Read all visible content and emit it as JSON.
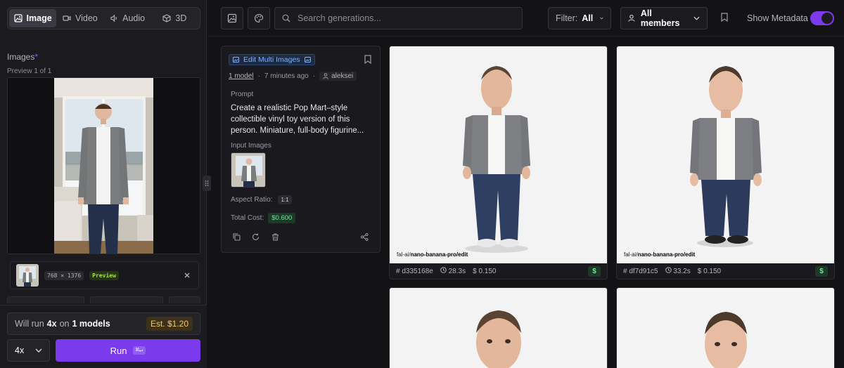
{
  "mode_tabs": [
    {
      "label": "Image",
      "icon": "image-icon",
      "active": true
    },
    {
      "label": "Video",
      "icon": "video-icon",
      "active": false
    },
    {
      "label": "Audio",
      "icon": "audio-icon",
      "active": false
    },
    {
      "label": "3D",
      "icon": "cube-icon",
      "active": false
    }
  ],
  "left_panel": {
    "images_label": "Images",
    "required_mark": "*",
    "preview_counter": "Preview 1 of 1",
    "file": {
      "dims": "768 × 1376",
      "badge": "Preview"
    },
    "will_run": {
      "prefix": "Will run",
      "count": "4x",
      "mid": "on",
      "models": "1 models",
      "estimate": "Est. $1.20"
    },
    "multiplier": "4x",
    "run_label": "Run",
    "run_shortcut": "⌘↵"
  },
  "topbar": {
    "search_placeholder": "Search generations...",
    "filter_label": "Filter:",
    "filter_value": "All",
    "members_label": "All members",
    "metadata_label": "Show Metadata",
    "metadata_on": true
  },
  "info_card": {
    "model_badge": "Edit Multi Images",
    "models": "1 model",
    "sep": "·",
    "time": "7 minutes ago",
    "user": "aleksei",
    "prompt_label": "Prompt",
    "prompt": "Create a realistic Pop Mart–style collectible vinyl toy version of this person. Miniature, full-body figurine...",
    "input_images_label": "Input Images",
    "aspect_label": "Aspect Ratio:",
    "aspect_value": "1:1",
    "cost_label": "Total Cost:",
    "cost_value": "$0.600"
  },
  "results": [
    {
      "model_prefix": "fal-ai/",
      "model_name": "nano-banana-pro/edit",
      "hash": "d335168e",
      "duration": "28.3s",
      "cost": "0.150",
      "badge": "$"
    },
    {
      "model_prefix": "fal-ai/",
      "model_name": "nano-banana-pro/edit",
      "hash": "df7d91c5",
      "duration": "33.2s",
      "cost": "0.150",
      "badge": "$"
    }
  ],
  "colors": {
    "accent": "#7c3aed",
    "background": "#131316",
    "panel": "#1b1b1f"
  }
}
